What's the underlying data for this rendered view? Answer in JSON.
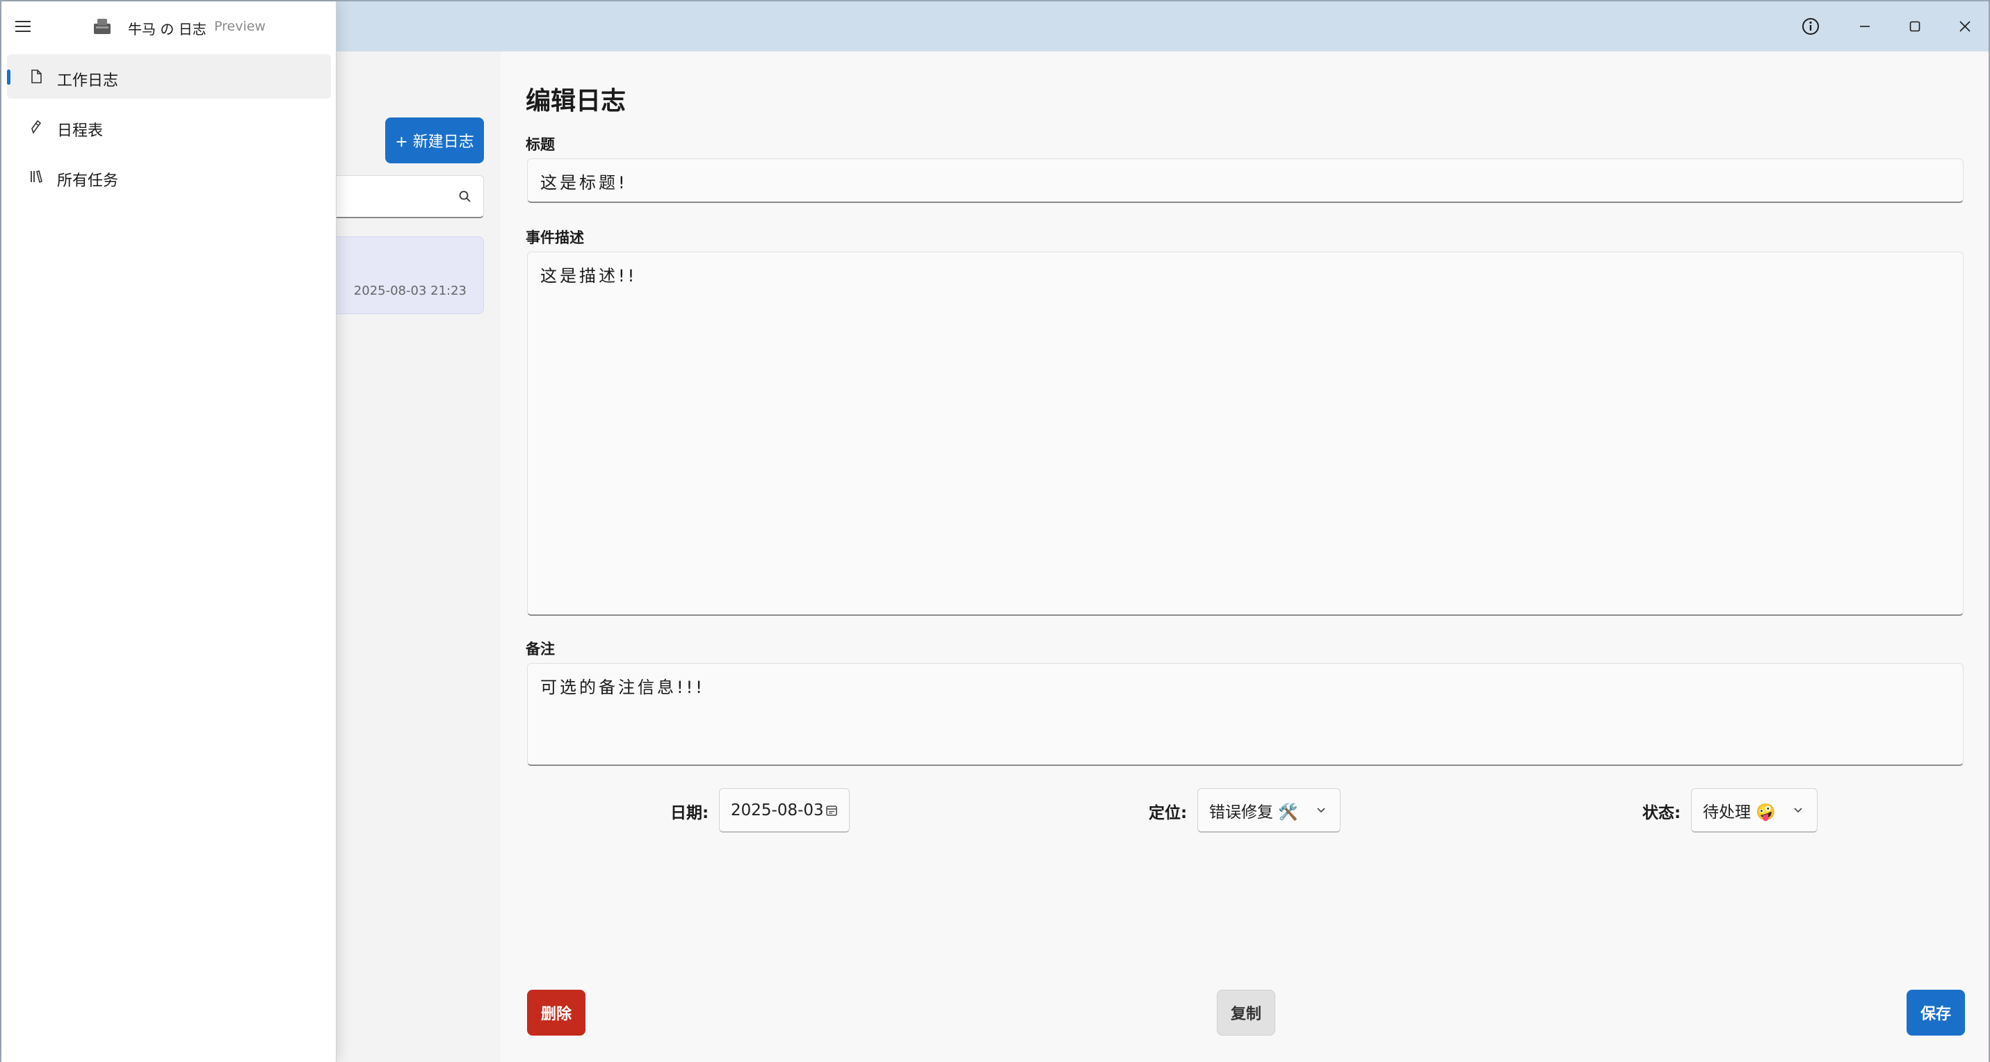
{
  "app": {
    "name": "牛马 の 日志",
    "tag": "Preview"
  },
  "nav": {
    "items": [
      {
        "label": "工作日志",
        "icon": "document-icon",
        "active": true
      },
      {
        "label": "日程表",
        "icon": "calendar-icon",
        "active": false
      },
      {
        "label": "所有任务",
        "icon": "library-icon",
        "active": false
      }
    ]
  },
  "list": {
    "new_label": "+ 新建日志",
    "search_placeholder": "",
    "entries": [
      {
        "date": "2025-08-03 21:23"
      }
    ]
  },
  "editor": {
    "page_title": "编辑日志",
    "title_label": "标题",
    "title_value": "这是标题!",
    "desc_label": "事件描述",
    "desc_value": "这是描述!!",
    "notes_label": "备注",
    "notes_value": "可选的备注信息!!!",
    "date_label": "日期:",
    "date_value": "2025-08-03",
    "category_label": "定位:",
    "category_value": "错误修复 🛠️",
    "status_label": "状态:",
    "status_value": "待处理 🤪",
    "delete_label": "删除",
    "copy_label": "复制",
    "save_label": "保存"
  },
  "colors": {
    "accent": "#1a70c9",
    "danger": "#c42b1c",
    "titlebar": "#cfdeec"
  }
}
